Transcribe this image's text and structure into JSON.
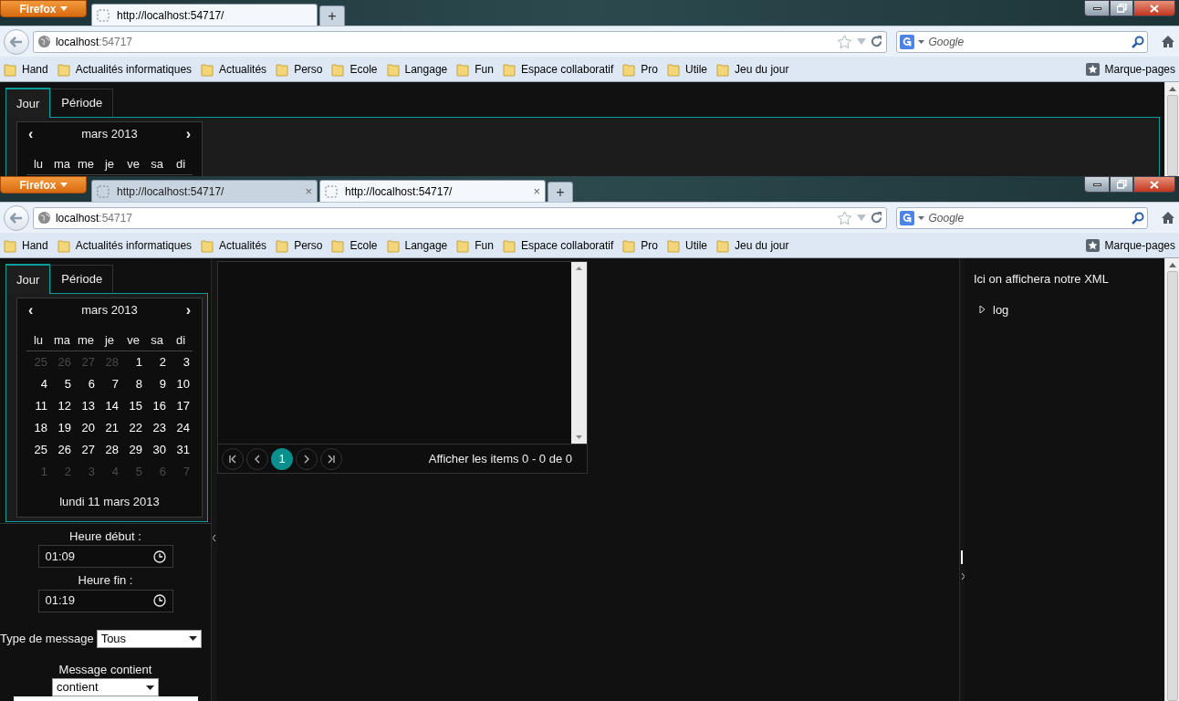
{
  "windows": [
    {
      "browser": {
        "menu_button": "Firefox",
        "tabs": [
          {
            "title": "http://localhost:54717/",
            "selected": true
          }
        ],
        "new_tab": "+",
        "url_host": "localhost",
        "url_port": ":54717",
        "search_placeholder": "Google",
        "bookmarks": [
          "Hand",
          "Actualités informatiques",
          "Actualités",
          "Perso",
          "Ecole",
          "Langage",
          "Fun",
          "Espace collaboratif",
          "Pro",
          "Utile",
          "Jeu du jour"
        ],
        "bookmarks_menu": "Marque-pages"
      },
      "page": {
        "mode_tabs": [
          {
            "label": "Jour",
            "selected": true
          },
          {
            "label": "Période",
            "selected": false
          }
        ],
        "calendar": {
          "prev": "‹",
          "month": "mars 2013",
          "next": "›",
          "weekdays": [
            "lu",
            "ma",
            "me",
            "je",
            "ve",
            "sa",
            "di"
          ]
        }
      }
    },
    {
      "browser": {
        "menu_button": "Firefox",
        "tabs": [
          {
            "title": "http://localhost:54717/",
            "close": "×",
            "selected": false
          },
          {
            "title": "http://localhost:54717/",
            "close": "×",
            "selected": true
          }
        ],
        "new_tab": "+",
        "url_host": "localhost",
        "url_port": ":54717",
        "search_placeholder": "Google",
        "bookmarks": [
          "Hand",
          "Actualités informatiques",
          "Actualités",
          "Perso",
          "Ecole",
          "Langage",
          "Fun",
          "Espace collaboratif",
          "Pro",
          "Utile",
          "Jeu du jour"
        ],
        "bookmarks_menu": "Marque-pages"
      },
      "page": {
        "mode_tabs": [
          {
            "label": "Jour",
            "selected": true
          },
          {
            "label": "Période",
            "selected": false
          }
        ],
        "calendar": {
          "prev": "‹",
          "month": "mars 2013",
          "next": "›",
          "weekdays": [
            "lu",
            "ma",
            "me",
            "je",
            "ve",
            "sa",
            "di"
          ],
          "weeks": [
            [
              {
                "day": "25",
                "other_month": true
              },
              {
                "day": "26",
                "other_month": true
              },
              {
                "day": "27",
                "other_month": true
              },
              {
                "day": "28",
                "other_month": true
              },
              {
                "day": "1",
                "other_month": false
              },
              {
                "day": "2",
                "other_month": false
              },
              {
                "day": "3",
                "other_month": false
              }
            ],
            [
              {
                "day": "4",
                "other_month": false
              },
              {
                "day": "5",
                "other_month": false
              },
              {
                "day": "6",
                "other_month": false
              },
              {
                "day": "7",
                "other_month": false
              },
              {
                "day": "8",
                "other_month": false
              },
              {
                "day": "9",
                "other_month": false
              },
              {
                "day": "10",
                "other_month": false
              }
            ],
            [
              {
                "day": "11",
                "other_month": false
              },
              {
                "day": "12",
                "other_month": false
              },
              {
                "day": "13",
                "other_month": false
              },
              {
                "day": "14",
                "other_month": false
              },
              {
                "day": "15",
                "other_month": false
              },
              {
                "day": "16",
                "other_month": false
              },
              {
                "day": "17",
                "other_month": false
              }
            ],
            [
              {
                "day": "18",
                "other_month": false
              },
              {
                "day": "19",
                "other_month": false
              },
              {
                "day": "20",
                "other_month": false
              },
              {
                "day": "21",
                "other_month": false
              },
              {
                "day": "22",
                "other_month": false
              },
              {
                "day": "23",
                "other_month": false
              },
              {
                "day": "24",
                "other_month": false
              }
            ],
            [
              {
                "day": "25",
                "other_month": false
              },
              {
                "day": "26",
                "other_month": false
              },
              {
                "day": "27",
                "other_month": false
              },
              {
                "day": "28",
                "other_month": false
              },
              {
                "day": "29",
                "other_month": false
              },
              {
                "day": "30",
                "other_month": false
              },
              {
                "day": "31",
                "other_month": false
              }
            ],
            [
              {
                "day": "1",
                "other_month": true
              },
              {
                "day": "2",
                "other_month": true
              },
              {
                "day": "3",
                "other_month": true
              },
              {
                "day": "4",
                "other_month": true
              },
              {
                "day": "5",
                "other_month": true
              },
              {
                "day": "6",
                "other_month": true
              },
              {
                "day": "7",
                "other_month": true
              }
            ]
          ],
          "footer": "lundi 11 mars 2013"
        },
        "start_time": {
          "label": "Heure début :",
          "value": "01:09"
        },
        "end_time": {
          "label": "Heure fin :",
          "value": "01:19"
        },
        "message_type": {
          "label": "Type de message",
          "value": "Tous"
        },
        "message_filter": {
          "label": "Message contient",
          "operator": "contient"
        },
        "grid": {
          "pages": [
            {
              "label": "1",
              "selected": true
            }
          ],
          "summary": "Afficher les items 0 - 0 de 0"
        },
        "xml_panel": {
          "title": "Ici on affichera notre XML",
          "nodes": [
            {
              "label": "log",
              "expanded": false
            }
          ]
        }
      }
    }
  ]
}
